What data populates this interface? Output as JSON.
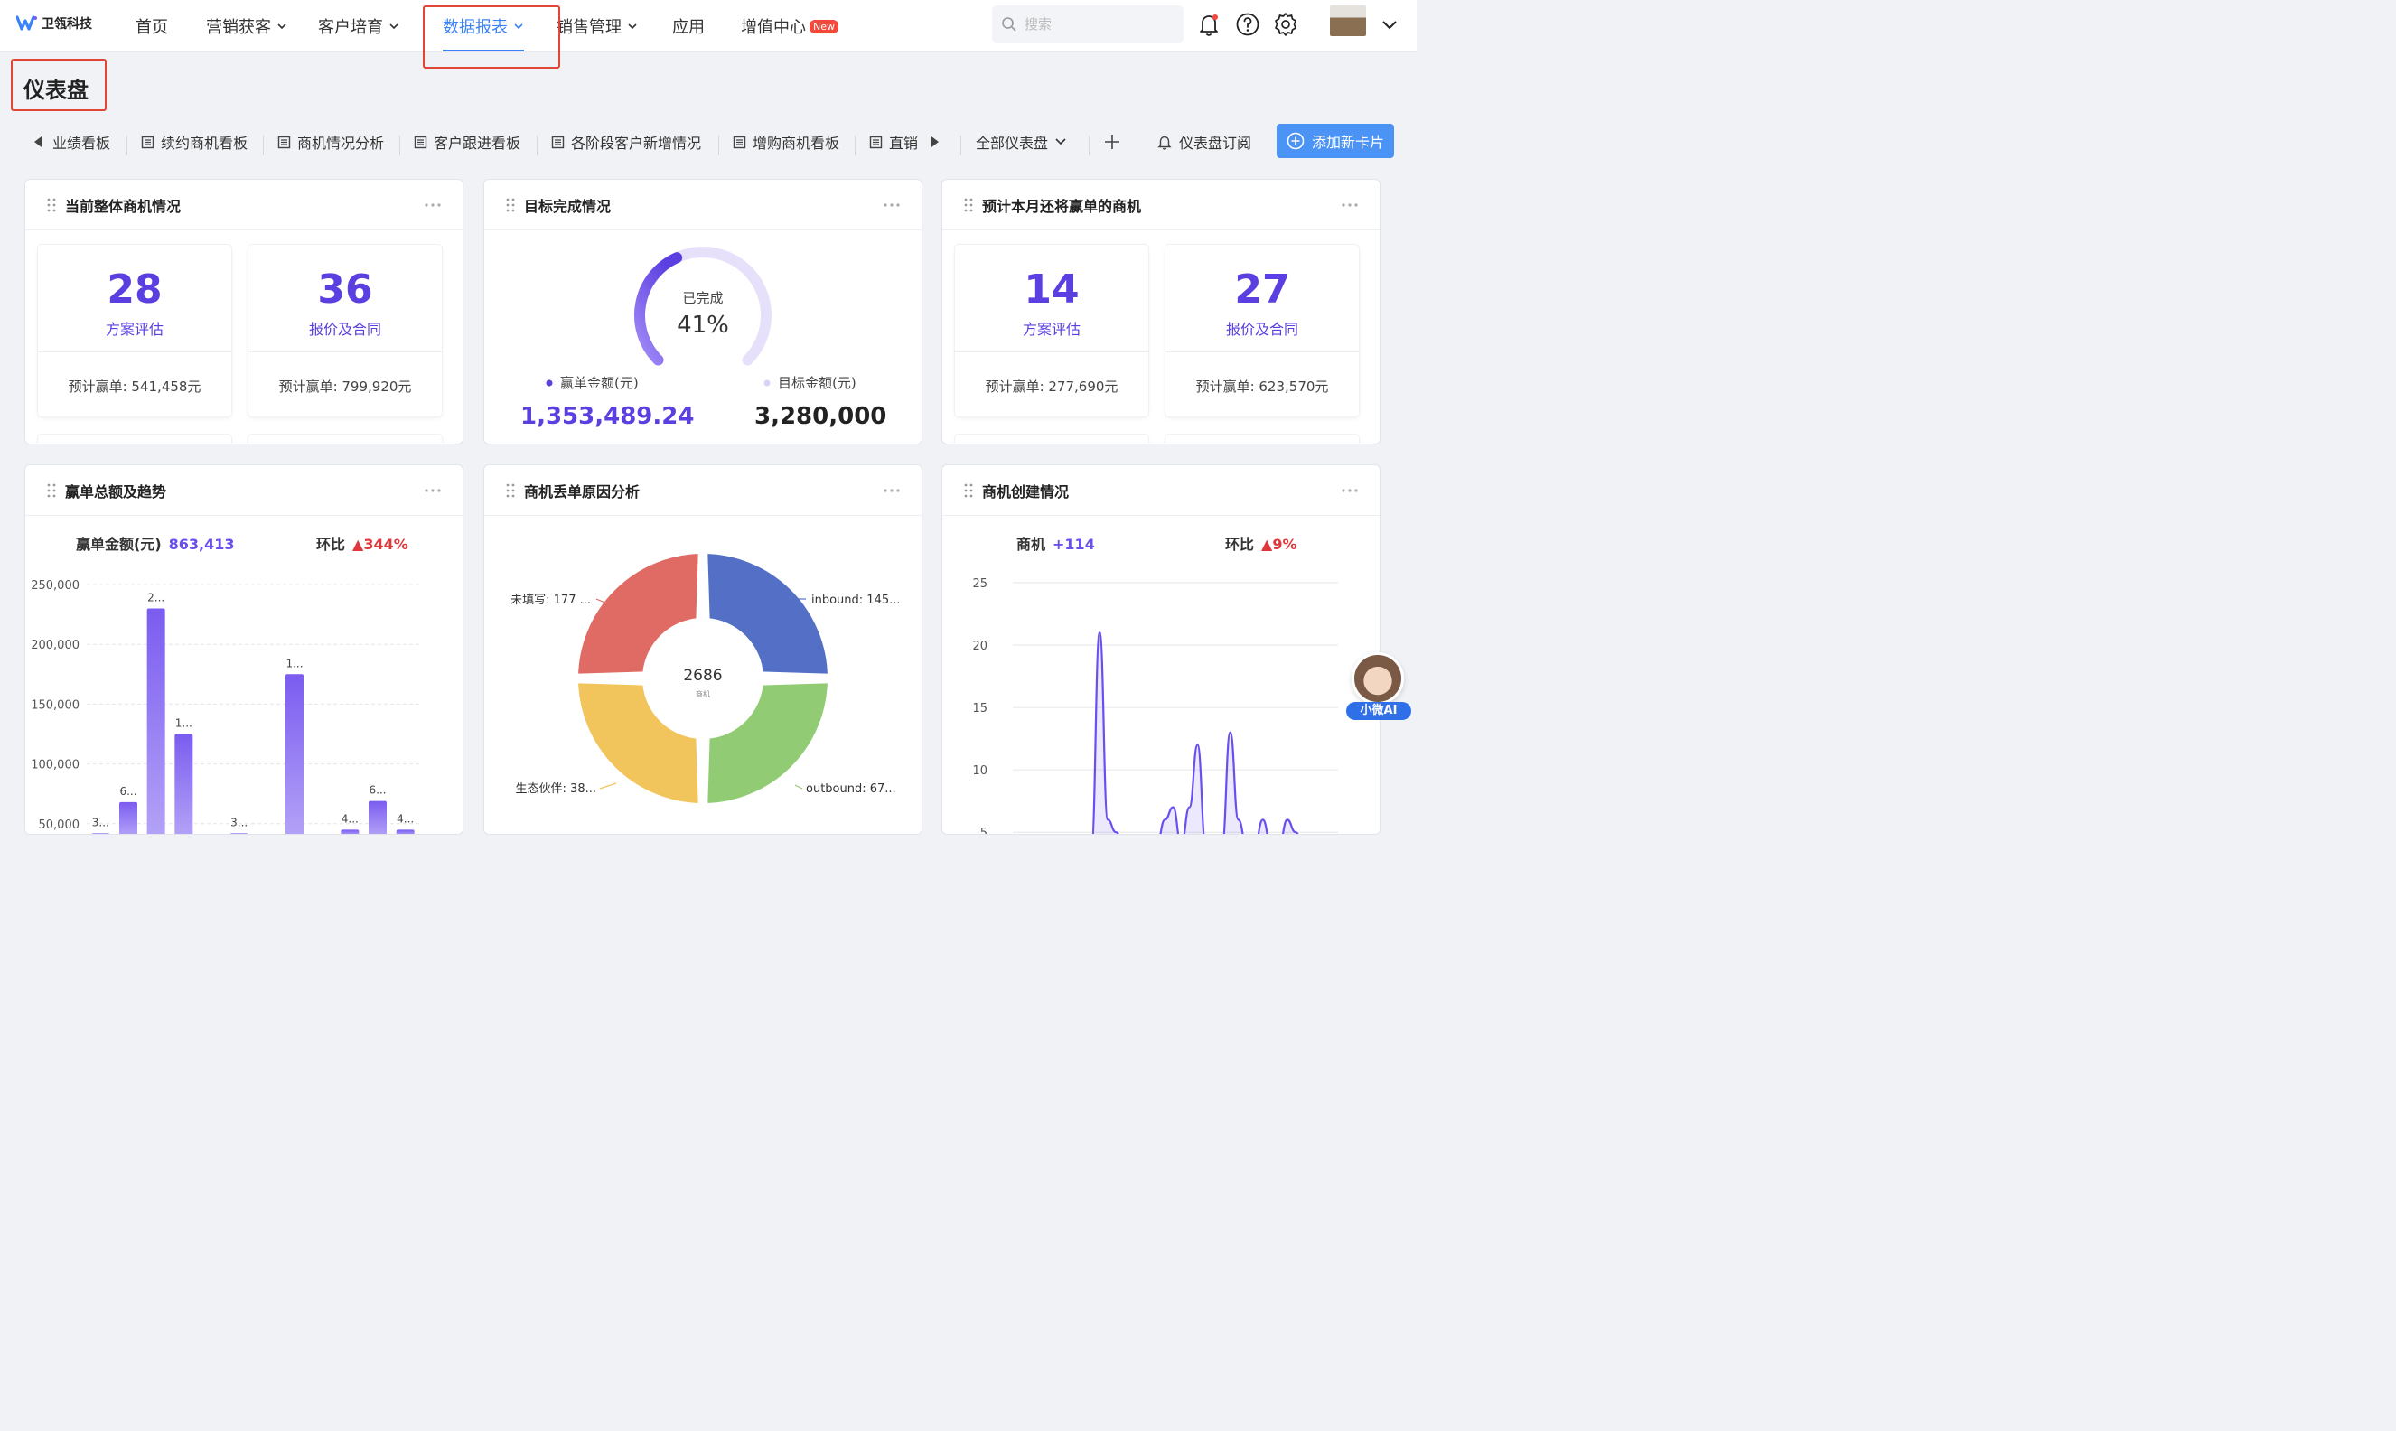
{
  "brand": {
    "name": "卫瓴科技",
    "accent": "#3b82f6",
    "primary": "#5b3fe0"
  },
  "nav": [
    {
      "label": "首页",
      "dropdown": false
    },
    {
      "label": "营销获客",
      "dropdown": true
    },
    {
      "label": "客户培育",
      "dropdown": true
    },
    {
      "label": "数据报表",
      "dropdown": true,
      "active": true
    },
    {
      "label": "销售管理",
      "dropdown": true
    },
    {
      "label": "应用",
      "dropdown": false
    },
    {
      "label": "增值中心",
      "dropdown": false,
      "badge": "New"
    }
  ],
  "search": {
    "placeholder": "搜索"
  },
  "page": {
    "title": "仪表盘"
  },
  "tabs": {
    "items": [
      "业绩看板",
      "续约商机看板",
      "商机情况分析",
      "客户跟进看板",
      "各阶段客户新增情况",
      "增购商机看板",
      "直销"
    ],
    "all_dashboards": "全部仪表盘",
    "subscribe": "仪表盘订阅",
    "add_card": "添加新卡片"
  },
  "cards": {
    "overall": {
      "title": "当前整体商机情况",
      "stats": [
        {
          "value": "28",
          "label": "方案评估",
          "sub": "预计赢单: 541,458元"
        },
        {
          "value": "36",
          "label": "报价及合同",
          "sub": "预计赢单: 799,920元"
        }
      ]
    },
    "target": {
      "title": "目标完成情况",
      "gauge_label": "已完成",
      "gauge_value": "41%",
      "percent": 41,
      "won_label": "赢单金额(元)",
      "won_value": "1,353,489.24",
      "target_label": "目标金额(元)",
      "target_value": "3,280,000"
    },
    "month": {
      "title": "预计本月还将赢单的商机",
      "stats": [
        {
          "value": "14",
          "label": "方案评估",
          "sub": "预计赢单: 277,690元"
        },
        {
          "value": "27",
          "label": "报价及合同",
          "sub": "预计赢单: 623,570元"
        }
      ]
    },
    "won_trend": {
      "title": "赢单总额及趋势",
      "amount_label": "赢单金额(元)",
      "amount_value": "863,413",
      "mom_label": "环比",
      "mom_value": "▲344%"
    },
    "lost": {
      "title": "商机丢单原因分析"
    },
    "created": {
      "title": "商机创建情况",
      "count_label": "商机",
      "count_value": "+114",
      "mom_label": "环比",
      "mom_value": "▲9%"
    }
  },
  "assistant": {
    "label": "小微AI"
  },
  "chart_data": [
    {
      "type": "bar",
      "yticks": [
        "250,000",
        "200,000",
        "150,000",
        "100,000",
        "50,000"
      ],
      "ylim": [
        40000,
        250000
      ],
      "series": [
        {
          "values": [
            42000,
            68000,
            230000,
            125000,
            null,
            42000,
            null,
            175000,
            null,
            45000,
            69000,
            45000
          ]
        }
      ],
      "data_labels": [
        "3...",
        "6...",
        "2...",
        "1...",
        "",
        "3...",
        "",
        "1...",
        "",
        "4...",
        "6...",
        "4..."
      ],
      "colors": [
        "#7b5cf0",
        "#b3a2f7"
      ]
    },
    {
      "type": "pie",
      "center_value": "2686",
      "center_label": "商机",
      "slices": [
        {
          "label": "inbound: 145...",
          "color": "#5470c6",
          "value": 1
        },
        {
          "label": "outbound: 67...",
          "color": "#91cc75",
          "value": 1
        },
        {
          "label": "生态伙伴: 38...",
          "color": "#f2c55c",
          "value": 1
        },
        {
          "label": "未填写: 177 ...",
          "color": "#e06a64",
          "value": 1
        }
      ]
    },
    {
      "type": "area",
      "yticks": [
        "25",
        "20",
        "15",
        "10",
        "5"
      ],
      "ylim": [
        4,
        25
      ],
      "series": [
        {
          "values": [
            4,
            4,
            4,
            4,
            21,
            6,
            5,
            4,
            4,
            4,
            4,
            4,
            6,
            7,
            4,
            7,
            12,
            4,
            4,
            4,
            13,
            6,
            4,
            4,
            6,
            4,
            4,
            6,
            5,
            4,
            4,
            4
          ]
        }
      ],
      "color": "#6a4ef0"
    }
  ]
}
